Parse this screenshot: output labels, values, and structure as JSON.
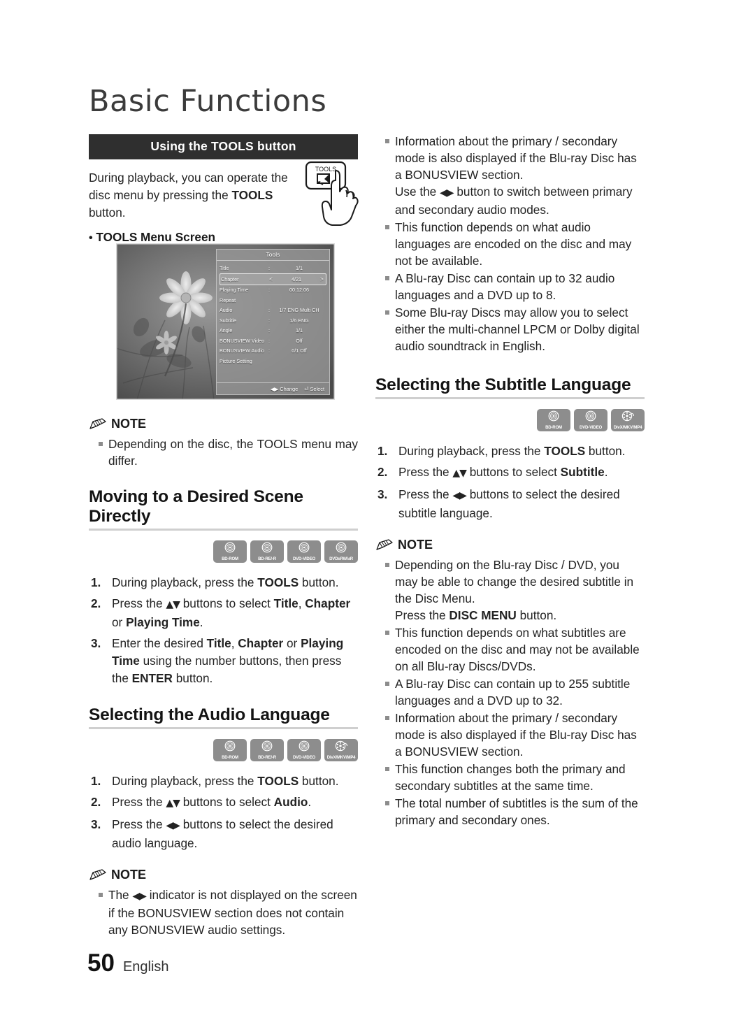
{
  "chapter_title": "Basic Functions",
  "section_bar": {
    "label": "Using the TOOLS button"
  },
  "intro": {
    "text_part1": "During playback, you can operate the disc menu by pressing the ",
    "text_bold": "TOOLS",
    "text_part2": " button.",
    "remote_button_label": "TOOLS"
  },
  "tools_menu_screen": {
    "caption_bullet": "•",
    "caption": "TOOLS Menu Screen",
    "panel_title": "Tools",
    "rows": [
      {
        "label": "Title",
        "sep": ":",
        "value": "1/1",
        "selected": false
      },
      {
        "label": "Chapter",
        "sep": "",
        "value": "4/21",
        "selected": true,
        "left_arrow": "<",
        "right_arrow": ">"
      },
      {
        "label": "Playing Time",
        "sep": ":",
        "value": "00:12:06",
        "selected": false
      },
      {
        "label": "Repeat",
        "sep": "",
        "value": "",
        "selected": false
      },
      {
        "label": "Audio",
        "sep": ":",
        "value": "1/7 ENG Multi CH",
        "selected": false
      },
      {
        "label": "Subtitle",
        "sep": ":",
        "value": "1/6 ENG",
        "selected": false
      },
      {
        "label": "Angle",
        "sep": ":",
        "value": "1/1",
        "selected": false
      },
      {
        "label": "BONUSVIEW Video",
        "sep": ":",
        "value": "Off",
        "selected": false
      },
      {
        "label": "BONUSVIEW Audio",
        "sep": ":",
        "value": "0/1 Off",
        "selected": false
      },
      {
        "label": "Picture Setting",
        "sep": "",
        "value": "",
        "selected": false
      }
    ],
    "footer_change": "Change",
    "footer_change_icon": "◀▶",
    "footer_select": "Select",
    "footer_select_icon": "⏎"
  },
  "note_tools": {
    "title": "NOTE",
    "items": [
      "Depending on the disc, the TOOLS menu may differ."
    ]
  },
  "moving_scene": {
    "heading": "Moving to a Desired Scene Directly",
    "discs": [
      "BD-ROM",
      "BD-RE/-R",
      "DVD-VIDEO",
      "DVD±RW/±R"
    ],
    "steps": [
      {
        "num": "1.",
        "html": "During playback, press the <b>TOOLS</b> button."
      },
      {
        "num": "2.",
        "html": "Press the <span class='arrowglyph'>▲▼</span> buttons to select <b>Title</b>, <b>Chapter</b> or <b>Playing Time</b>."
      },
      {
        "num": "3.",
        "html": "Enter the desired <b>Title</b>, <b>Chapter</b> or <b>Playing Time</b> using the number buttons, then press the <b>ENTER</b> button."
      }
    ]
  },
  "audio_language": {
    "heading": "Selecting the Audio Language",
    "discs": [
      "BD-ROM",
      "BD-RE/-R",
      "DVD-VIDEO",
      "DivX/MKV/MP4"
    ],
    "steps": [
      {
        "num": "1.",
        "html": "During playback, press the <b>TOOLS</b> button."
      },
      {
        "num": "2.",
        "html": "Press the <span class='arrowglyph'>▲▼</span> buttons to select <b>Audio</b>."
      },
      {
        "num": "3.",
        "html": "Press the <span class='arrowglyph'>◀▶</span> buttons to select the desired audio language."
      }
    ],
    "note": {
      "title": "NOTE",
      "items": [
        "The <span class='arrowglyph'>◀▶</span> indicator is not displayed on the screen if the BONUSVIEW section does not contain any BONUSVIEW audio settings."
      ]
    }
  },
  "audio_notes_right": {
    "items": [
      "Information about the primary / secondary mode is also displayed if the Blu-ray Disc has a BONUSVIEW section.<br>Use the <span class='arrowglyph'>◀▶</span> button to switch between primary and secondary audio modes.",
      "This function depends on what audio languages are encoded on the disc and may not be available.",
      "A Blu-ray Disc can contain up to 32 audio languages and a DVD up to 8.",
      "Some Blu-ray Discs may allow you to select either the multi-channel LPCM or Dolby digital audio soundtrack in English."
    ]
  },
  "subtitle_language": {
    "heading": "Selecting the Subtitle Language",
    "discs": [
      "BD-ROM",
      "DVD-VIDEO",
      "DivX/MKV/MP4"
    ],
    "steps": [
      {
        "num": "1.",
        "html": "During playback, press the <b>TOOLS</b> button."
      },
      {
        "num": "2.",
        "html": "Press the <span class='arrowglyph'>▲▼</span> buttons to select <b>Subtitle</b>."
      },
      {
        "num": "3.",
        "html": "Press the <span class='arrowglyph'>◀▶</span> buttons to select the desired subtitle language."
      }
    ],
    "note": {
      "title": "NOTE",
      "items": [
        "Depending on the Blu-ray Disc / DVD, you may be able to change the desired subtitle in the Disc Menu.<br>Press the <b>DISC MENU</b> button.",
        "This function depends on what subtitles are encoded on the disc and may not be available on all Blu-ray Discs/DVDs.",
        "A Blu-ray Disc can contain up to 255 subtitle languages and a DVD up to 32.",
        "Information about the primary / secondary mode is also displayed if the Blu-ray Disc has a BONUSVIEW section.",
        "This function changes both the primary and secondary subtitles at the same time.",
        "The total number of subtitles is the sum of the primary and secondary ones."
      ]
    }
  },
  "footer": {
    "page_number": "50",
    "language": "English"
  },
  "colors": {
    "bar_bg": "#2f2f2f",
    "heading_rule": "#cfcfcf",
    "disc_badge": "#8d8d8d",
    "bullet": "#8c8c8c"
  }
}
